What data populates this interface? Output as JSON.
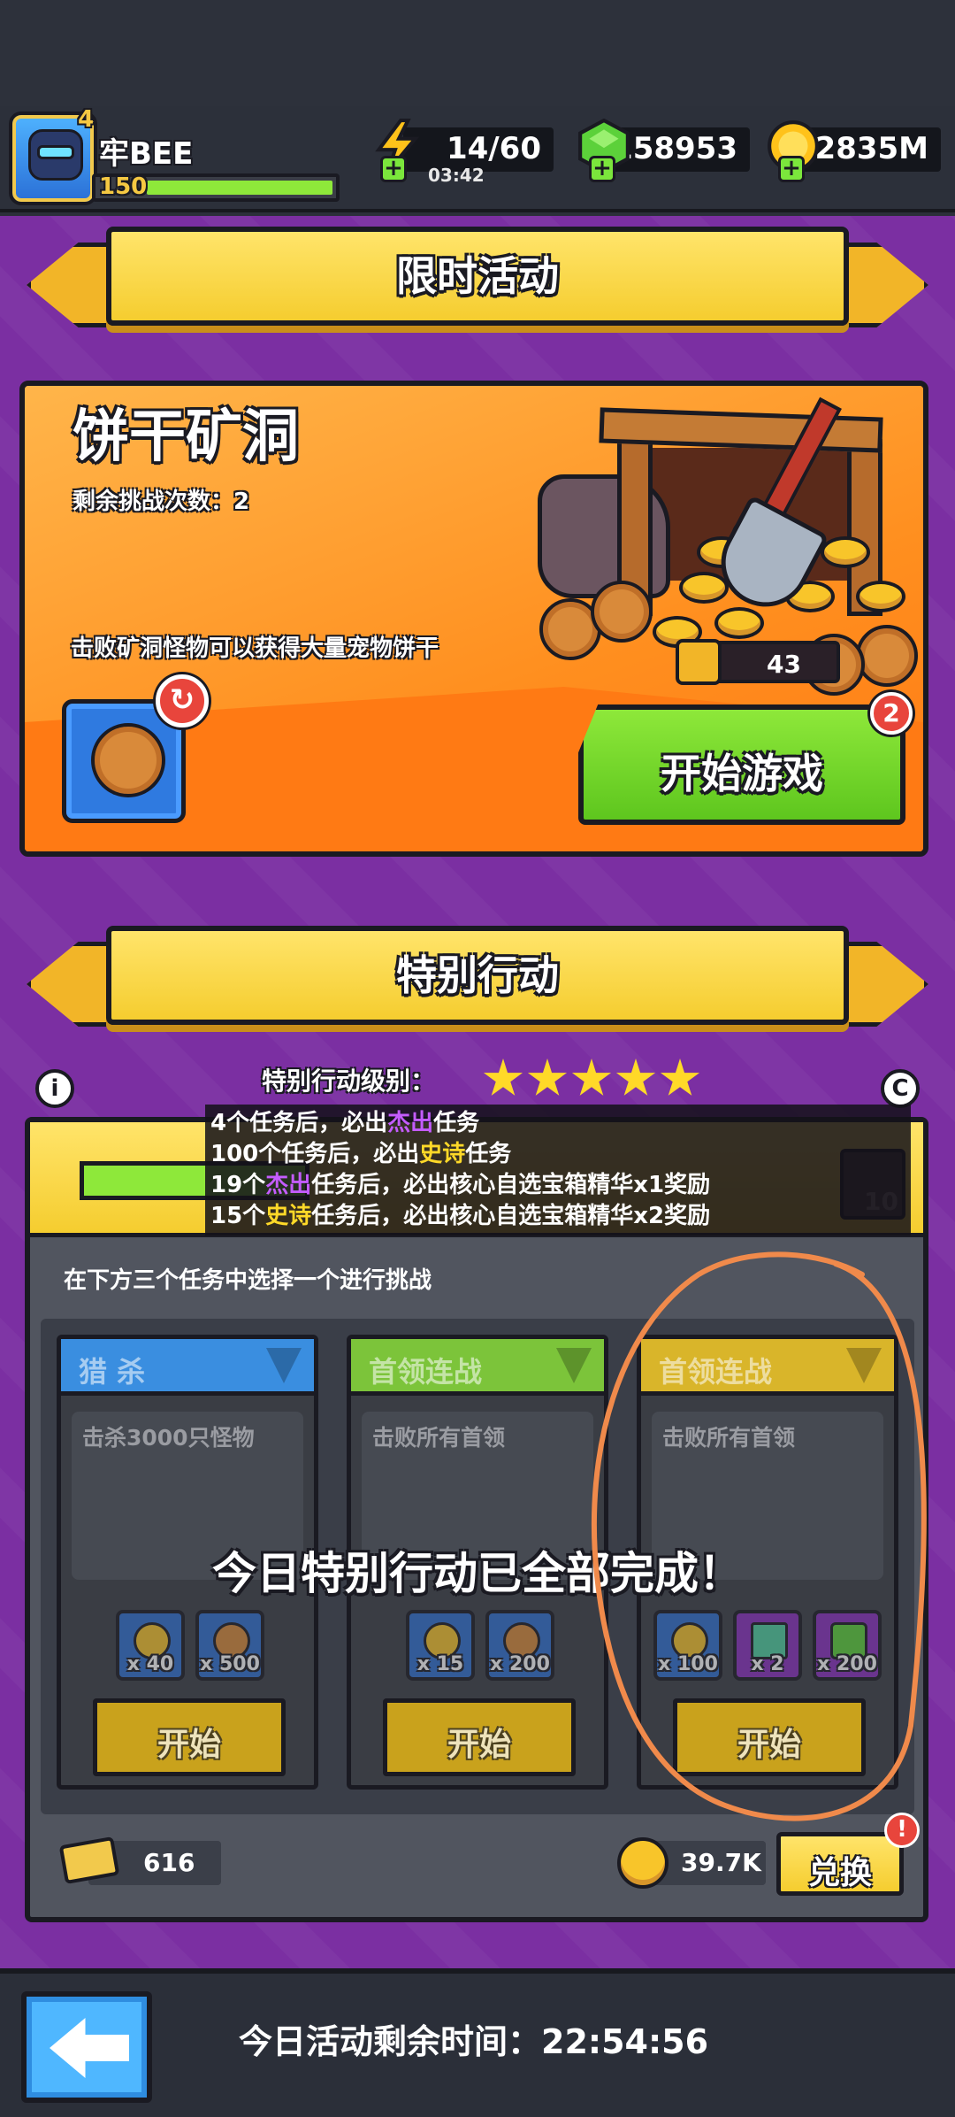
{
  "player": {
    "level": "4",
    "name": "牢BEE",
    "exp_level": "150"
  },
  "resources": {
    "energy": {
      "value": "14/60",
      "timer": "03:42",
      "icon": "lightning-icon"
    },
    "gems": {
      "value": "158953",
      "icon": "green-gem-icon"
    },
    "gold": {
      "value": "2835M",
      "icon": "gold-coin-icon"
    }
  },
  "limited_event": {
    "banner_title": "限时活动",
    "name": "饼干矿洞",
    "tries_label": "剩余挑战次数：2",
    "description": "击败矿洞怪物可以获得大量宠物饼干",
    "count": "43",
    "start_button": "开始游戏",
    "start_badge": "2"
  },
  "special_action": {
    "banner_title": "特别行动",
    "level_label": "特别行动级别：",
    "stars": 5,
    "chest_count": "10",
    "tooltip": [
      {
        "a": "4个任务后，必出",
        "hl": "杰出",
        "b": "任务",
        "color": "purple"
      },
      {
        "a": "100个任务后，必出",
        "hl": "史诗",
        "b": "任务",
        "color": "yellow"
      },
      {
        "a": "19个",
        "hl": "杰出",
        "b": "任务后，必出核心自选宝箱精华x1奖励",
        "color": "purple"
      },
      {
        "a": "15个",
        "hl": "史诗",
        "b": "任务后，必出核心自选宝箱精华x2奖励",
        "color": "yellow"
      }
    ],
    "choose_hint": "在下方三个任务中选择一个进行挑战",
    "tasks": [
      {
        "title": "猎 杀",
        "desc": "击杀3000只怪物",
        "color": "#3a8ee0",
        "rewards": [
          "x 40",
          "x 500"
        ],
        "button": "开始"
      },
      {
        "title": "首领连战",
        "desc": "击败所有首领",
        "color": "#7cc43a",
        "rewards": [
          "x 15",
          "x 200"
        ],
        "button": "开始"
      },
      {
        "title": "首领连战",
        "desc": "击败所有首领",
        "color": "#d9b52a",
        "rewards": [
          "x 100",
          "x 2",
          "x 200"
        ],
        "button": "开始"
      }
    ],
    "completed_message": "今日特别行动已全部完成！",
    "tickets": "616",
    "coins": "39.7K",
    "exchange_button": "兑换",
    "exchange_badge": "!"
  },
  "footer": {
    "remaining_label": "今日活动剩余时间：22:54:56"
  },
  "colors": {
    "purple_bg": "#7b2fa2",
    "banner_yellow": "#f5cd2f",
    "green_button": "#8ee83a",
    "annotation_orange": "#f08a4b"
  }
}
